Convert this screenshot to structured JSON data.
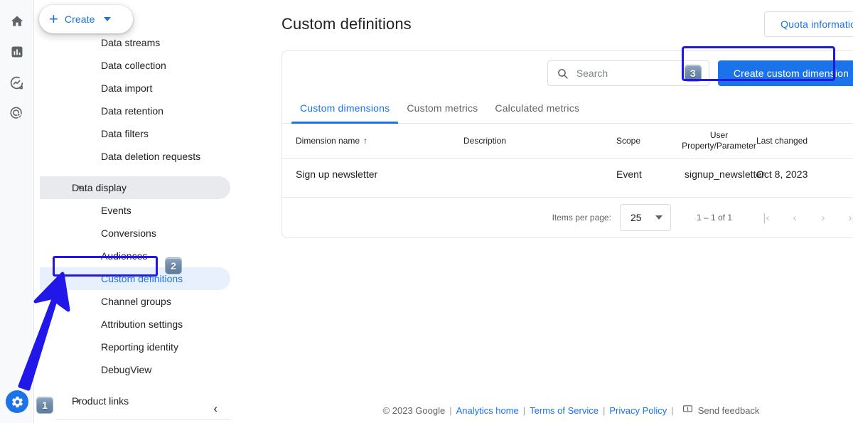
{
  "colors": {
    "accent": "#1a73e8",
    "annotation": "#2117e8",
    "selected_bg": "#e8f0fe",
    "expanded_bg": "#e8eaed"
  },
  "rail": {
    "icons": [
      {
        "name": "home-icon",
        "label": "Home"
      },
      {
        "name": "reports-icon",
        "label": "Reports"
      },
      {
        "name": "explore-icon",
        "label": "Explore"
      },
      {
        "name": "advertising-icon",
        "label": "Advertising"
      }
    ],
    "admin": {
      "name": "gear-icon",
      "label": "Admin"
    },
    "badge": "1"
  },
  "nav": {
    "create_button": {
      "label": "Create",
      "plus": "+"
    },
    "items": [
      {
        "label": "Data streams",
        "type": "leaf"
      },
      {
        "label": "Data collection",
        "type": "leaf"
      },
      {
        "label": "Data import",
        "type": "leaf"
      },
      {
        "label": "Data retention",
        "type": "leaf"
      },
      {
        "label": "Data filters",
        "type": "leaf"
      },
      {
        "label": "Data deletion requests",
        "type": "leaf"
      },
      {
        "label": "Data display",
        "type": "group-expanded"
      },
      {
        "label": "Events",
        "type": "leaf"
      },
      {
        "label": "Conversions",
        "type": "leaf"
      },
      {
        "label": "Audiences",
        "type": "leaf"
      },
      {
        "label": "Custom definitions",
        "type": "leaf-selected"
      },
      {
        "label": "Channel groups",
        "type": "leaf"
      },
      {
        "label": "Attribution settings",
        "type": "leaf"
      },
      {
        "label": "Reporting identity",
        "type": "leaf"
      },
      {
        "label": "DebugView",
        "type": "leaf"
      },
      {
        "label": "Product links",
        "type": "group-collapsed"
      }
    ],
    "selected_badge": "2",
    "collapse_icon": "‹"
  },
  "header": {
    "title": "Custom definitions",
    "quota_button": "Quota information"
  },
  "toolbar": {
    "search_placeholder": "Search",
    "search_value": "",
    "search_icon": "search-icon",
    "search_badge": "3",
    "create_dimension_button": "Create custom dimension"
  },
  "tabs": [
    {
      "label": "Custom dimensions",
      "active": true
    },
    {
      "label": "Custom metrics",
      "active": false
    },
    {
      "label": "Calculated metrics",
      "active": false
    }
  ],
  "table": {
    "columns": [
      {
        "label": "Dimension name",
        "sorted": "asc",
        "sort_glyph": "↑"
      },
      {
        "label": "Description"
      },
      {
        "label": "Scope"
      },
      {
        "label": "User Property/Parameter"
      },
      {
        "label": "Last changed"
      },
      {
        "label": ""
      }
    ],
    "rows": [
      {
        "name": "Sign up newsletter",
        "description": "",
        "scope": "Event",
        "parameter": "signup_newsletter",
        "last_changed": "Oct 8, 2023"
      }
    ]
  },
  "pagination": {
    "items_per_page_label": "Items per page:",
    "items_per_page_value": "25",
    "range": "1 – 1 of 1",
    "first_icon": "|‹",
    "prev_icon": "‹",
    "next_icon": "›",
    "last_icon": "›|"
  },
  "footer": {
    "copyright": "© 2023 Google",
    "links": [
      {
        "label": "Analytics home"
      },
      {
        "label": "Terms of Service"
      },
      {
        "label": "Privacy Policy"
      }
    ],
    "separator": "|",
    "feedback": "Send feedback",
    "feedback_icon": "feedback-icon"
  }
}
